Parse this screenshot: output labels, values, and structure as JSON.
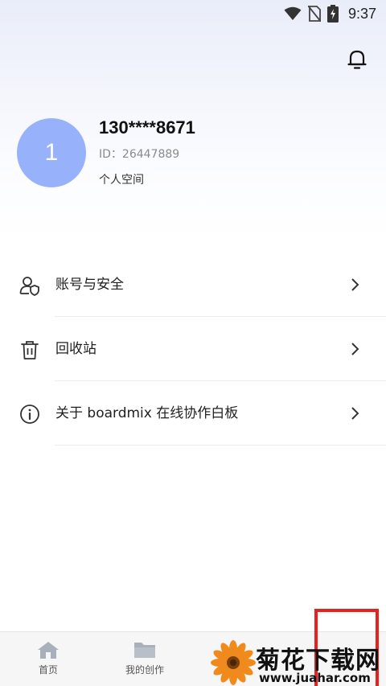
{
  "status_bar": {
    "time": "9:37",
    "icons": [
      "wifi-icon",
      "no-sim-icon",
      "battery-charging-icon"
    ]
  },
  "header": {
    "bell_icon": "bell-icon"
  },
  "profile": {
    "avatar_text": "1",
    "avatar_color": "#97b2fb",
    "username": "130****8671",
    "user_id": "ID：26447889",
    "space_label": "个人空间"
  },
  "menu": {
    "items": [
      {
        "label": "账号与安全",
        "icon": "user-shield-icon"
      },
      {
        "label": "回收站",
        "icon": "trash-icon"
      },
      {
        "label": "关于 boardmix 在线协作白板",
        "icon": "info-icon"
      }
    ]
  },
  "tabbar": {
    "tabs": [
      {
        "label": "首页",
        "icon": "home-icon"
      },
      {
        "label": "我的创作",
        "icon": "folder-icon"
      }
    ]
  },
  "watermark": {
    "title": "菊花下载网",
    "url": "www.juahar.com"
  },
  "colors": {
    "highlight_frame": "#e8211f"
  }
}
